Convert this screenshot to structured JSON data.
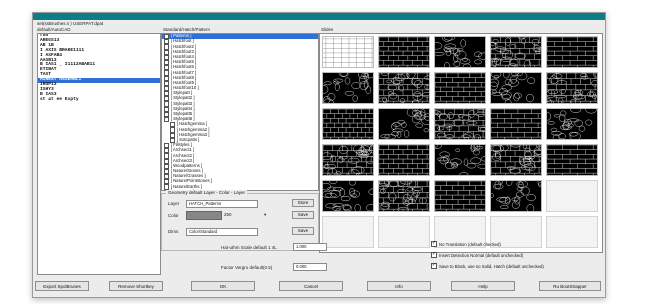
{
  "window": {
    "path": "set(ssBrushes.s ) USERPAT.dpat",
    "left_header": "default/AutoCAD",
    "middle_header": "Standard/Hatch/Pattern",
    "right_header": "Slides"
  },
  "left_list": {
    "items": [
      {
        "label": "run",
        "selected": false
      },
      {
        "label": "AREGS13",
        "selected": false
      },
      {
        "label": "AB 1B",
        "selected": false
      },
      {
        "label": "I AXIS BRAKE1111",
        "selected": false
      },
      {
        "label": "I ASFAB4",
        "selected": false
      },
      {
        "label": "AASB13",
        "selected": false
      },
      {
        "label": "B IAS1 _ I1112ABAB11",
        "selected": false
      },
      {
        "label": "ETIBAT",
        "selected": false
      },
      {
        "label": "TAST",
        "selected": false
      },
      {
        "label": "AIREST ASSEMBLI",
        "selected": true
      },
      {
        "label": "IROP13",
        "selected": false
      },
      {
        "label": "ISHY3",
        "selected": false
      },
      {
        "label": "B IAS3",
        "selected": false
      },
      {
        "label": "st at ee Expty",
        "selected": false
      }
    ]
  },
  "middle_list": {
    "items": [
      {
        "label": "[ Patterns ]",
        "selected": true,
        "sub": false
      },
      {
        "label": "[ Hatchfoot ]",
        "selected": false,
        "sub": false
      },
      {
        "label": "[ Hatchfoot2 ]",
        "selected": false,
        "sub": false
      },
      {
        "label": "[ Hatchfoot3 ]",
        "selected": false,
        "sub": false
      },
      {
        "label": "[ Hatchfoot4 ]",
        "selected": false,
        "sub": false
      },
      {
        "label": "[ Hatchfoot5 ]",
        "selected": false,
        "sub": false
      },
      {
        "label": "[ Hatchfoot6 ]",
        "selected": false,
        "sub": false
      },
      {
        "label": "[ Hatchfoot7 ]",
        "selected": false,
        "sub": false
      },
      {
        "label": "[ Hatchfoot8 ]",
        "selected": false,
        "sub": false
      },
      {
        "label": "[ Hatchfoot9 ]",
        "selected": false,
        "sub": false
      },
      {
        "label": "[ Hatchfoot10 ]",
        "selected": false,
        "sub": false
      },
      {
        "label": "[ Stylepatt ]",
        "selected": false,
        "sub": false
      },
      {
        "label": "[ Stylepatt2 ]",
        "selected": false,
        "sub": false
      },
      {
        "label": "[ Stylepatt3 ]",
        "selected": false,
        "sub": false
      },
      {
        "label": "[ Stylepatt4 ]",
        "selected": false,
        "sub": false
      },
      {
        "label": "[ Stylepatt5 ]",
        "selected": false,
        "sub": false
      },
      {
        "label": "[ Stylepatt6 ]",
        "selected": false,
        "sub": false
      },
      {
        "label": "[ Hatchgemma ]",
        "selected": false,
        "sub": true
      },
      {
        "label": "[ Hatchgemma2 ]",
        "selected": false,
        "sub": true
      },
      {
        "label": "[ Hatchgemma3 ]",
        "selected": false,
        "sub": true
      },
      {
        "label": "[ Sotcpatts ]",
        "selected": false,
        "sub": true
      },
      {
        "label": "[ Fillstyles ]",
        "selected": false,
        "sub": false
      },
      {
        "label": "[ Archsect1 ]",
        "selected": false,
        "sub": false
      },
      {
        "label": "[ Archsect2 ]",
        "selected": false,
        "sub": false
      },
      {
        "label": "[ Archsect3 ]",
        "selected": false,
        "sub": false
      },
      {
        "label": "[ Woodpatterns ]",
        "selected": false,
        "sub": false
      },
      {
        "label": "[ Nature/Stones ]",
        "selected": false,
        "sub": false
      },
      {
        "label": "[ Nature/Grasses ]",
        "selected": false,
        "sub": false
      },
      {
        "label": "[ Nature/Pointstones ]",
        "selected": false,
        "sub": false
      },
      {
        "label": "[ Nature/Earths ]",
        "selected": false,
        "sub": false
      },
      {
        "label": "[ Masonry1 ]",
        "selected": false,
        "sub": false
      },
      {
        "label": "[ Masonry2 ]",
        "selected": false,
        "sub": false
      },
      {
        "label": "[ Masonry3 ]",
        "selected": false,
        "sub": false
      },
      {
        "label": "[ Masonry4 ]",
        "selected": false,
        "sub": false
      }
    ]
  },
  "group": {
    "title": "Geometry default Layer - Color - Layer",
    "layer_label": "Layer",
    "layer_value": "HATCH_Patterns",
    "layer_button": "Store",
    "color_label": "Color",
    "color_value": "250",
    "color_button": "Save",
    "dims_label": "Dims",
    "dims_value": "Color/Standard",
    "dims_button": "Save"
  },
  "options": {
    "scale_label": "Hat-uIhm  Scale  default  1 4L",
    "scale_value": "1.000",
    "factor_label": "Factor    Vergro  default(0.5)",
    "factor_value": "0.000",
    "check1": {
      "label": "No Translation (default checked)",
      "checked": true
    },
    "check2": {
      "label": "Insert Detection Normal  (default unchecked)",
      "checked": true
    },
    "check3": {
      "label": "Save to Block, use no Solid, Hatch (default unchecked)",
      "checked": true
    }
  },
  "footer": {
    "export_label": "Export SpolBrunes",
    "remove_label": "Remove Shortkey",
    "ok_label": "OK",
    "cancel_label": "Cancel",
    "info_label": "Info",
    "help_label": "Help",
    "about_label": "Ru BootStrapper"
  },
  "grid": {
    "filled_count": 24,
    "empty_count": 6
  },
  "colors": {
    "titlebar": "#0c7e86",
    "selection": "#2f6fd6"
  }
}
